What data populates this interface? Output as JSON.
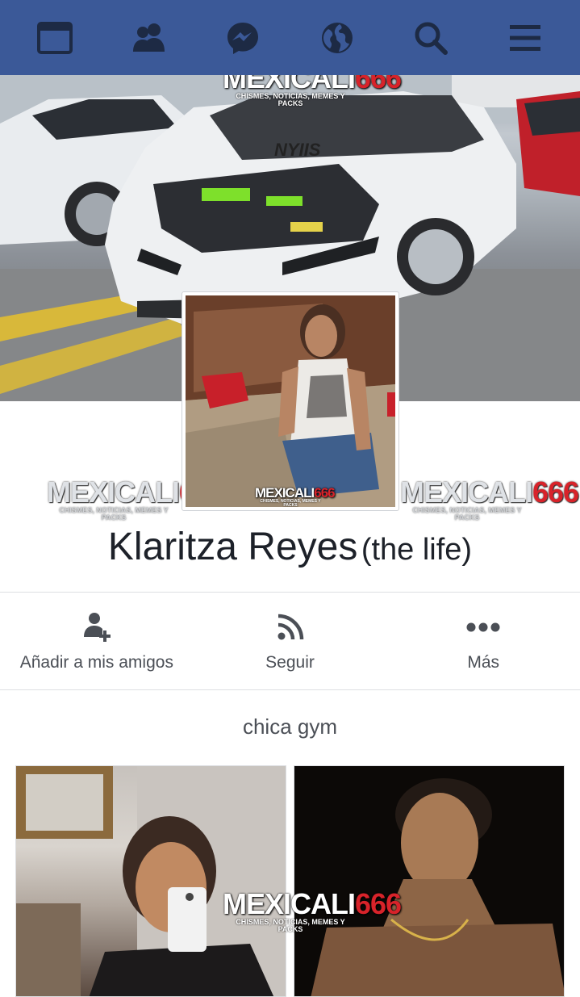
{
  "nav": {
    "items": [
      {
        "name": "news-feed-icon"
      },
      {
        "name": "friend-requests-icon"
      },
      {
        "name": "messenger-icon"
      },
      {
        "name": "notifications-globe-icon"
      },
      {
        "name": "search-icon"
      },
      {
        "name": "menu-icon"
      }
    ],
    "color": "#3b5998"
  },
  "watermark": {
    "brand_text": "MEXICALI",
    "brand_num": "666",
    "tagline": "CHISMES, NOTICIAS, MEMES Y PACKS"
  },
  "profile": {
    "name": "Klaritza Reyes",
    "alt_name": "(the life)",
    "bio": "chica gym"
  },
  "actions": [
    {
      "label": "Añadir a mis amigos",
      "icon": "add-friend-icon"
    },
    {
      "label": "Seguir",
      "icon": "follow-rss-icon"
    },
    {
      "label": "Más",
      "icon": "more-dots-icon"
    }
  ],
  "cover_texts": {
    "plate_text": "NYIIS"
  }
}
